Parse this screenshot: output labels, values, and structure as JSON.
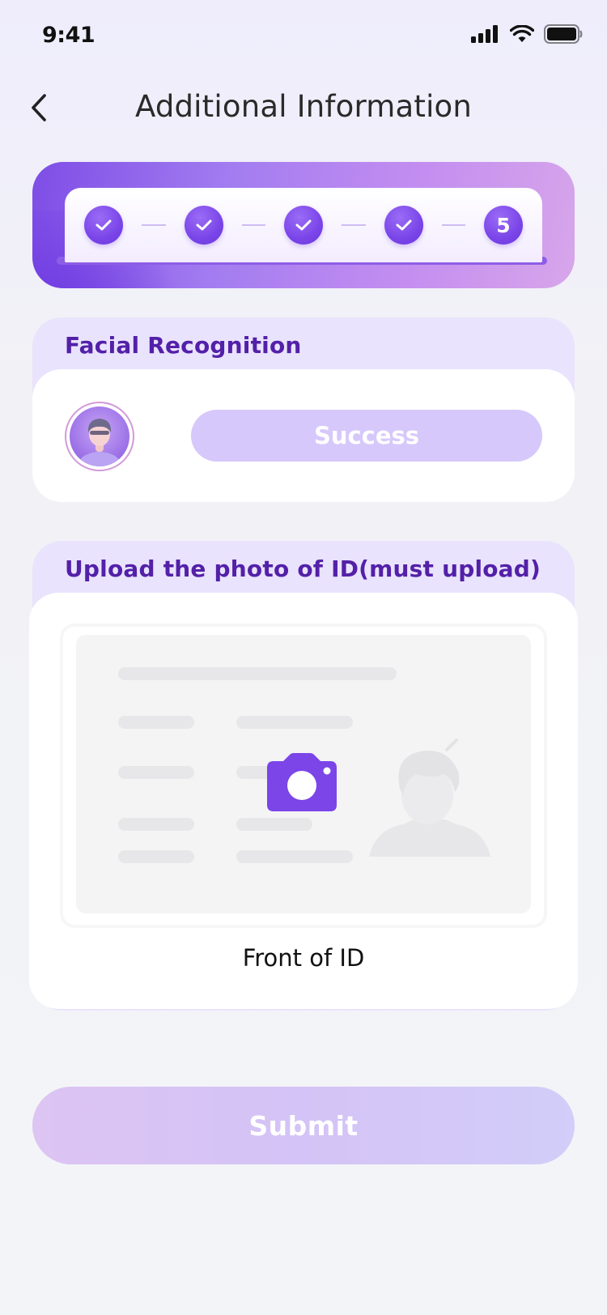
{
  "status_bar": {
    "time": "9:41"
  },
  "header": {
    "title": "Additional Information"
  },
  "stepper": {
    "steps": [
      {
        "state": "done"
      },
      {
        "state": "done"
      },
      {
        "state": "done"
      },
      {
        "state": "done"
      },
      {
        "state": "current",
        "label": "5"
      }
    ]
  },
  "facial": {
    "title": "Facial Recognition",
    "status_label": "Success"
  },
  "id_upload": {
    "title": "Upload the photo of ID(must upload)",
    "front_label": "Front of ID"
  },
  "submit": {
    "label": "Submit"
  },
  "colors": {
    "accent": "#7a45e8",
    "title_purple": "#5320a8",
    "section_bg": "#e9e3fd"
  }
}
